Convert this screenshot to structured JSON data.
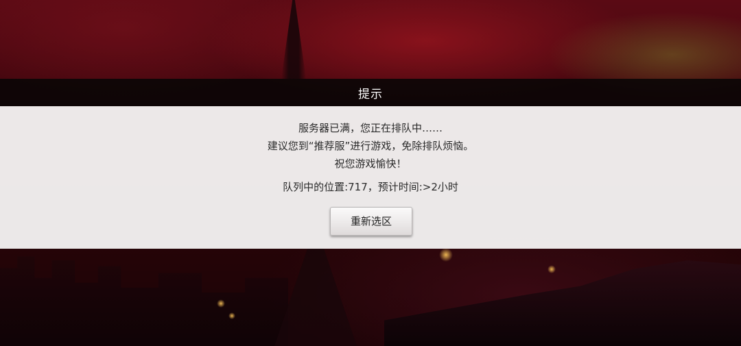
{
  "dialog": {
    "title": "提示",
    "message_lines": [
      "服务器已满，您正在排队中……",
      "建议您到“推荐服”进行游戏，免除排队烦恼。",
      "祝您游戏愉快！"
    ],
    "queue_info": "队列中的位置:717，预计时间:>2小时",
    "reselect_button_label": "重新选区"
  },
  "colors": {
    "title_bar_bg": "#080606",
    "panel_bg": "#f4f1f1",
    "text": "#2a2a2a",
    "background_red": "#5a0a14"
  }
}
